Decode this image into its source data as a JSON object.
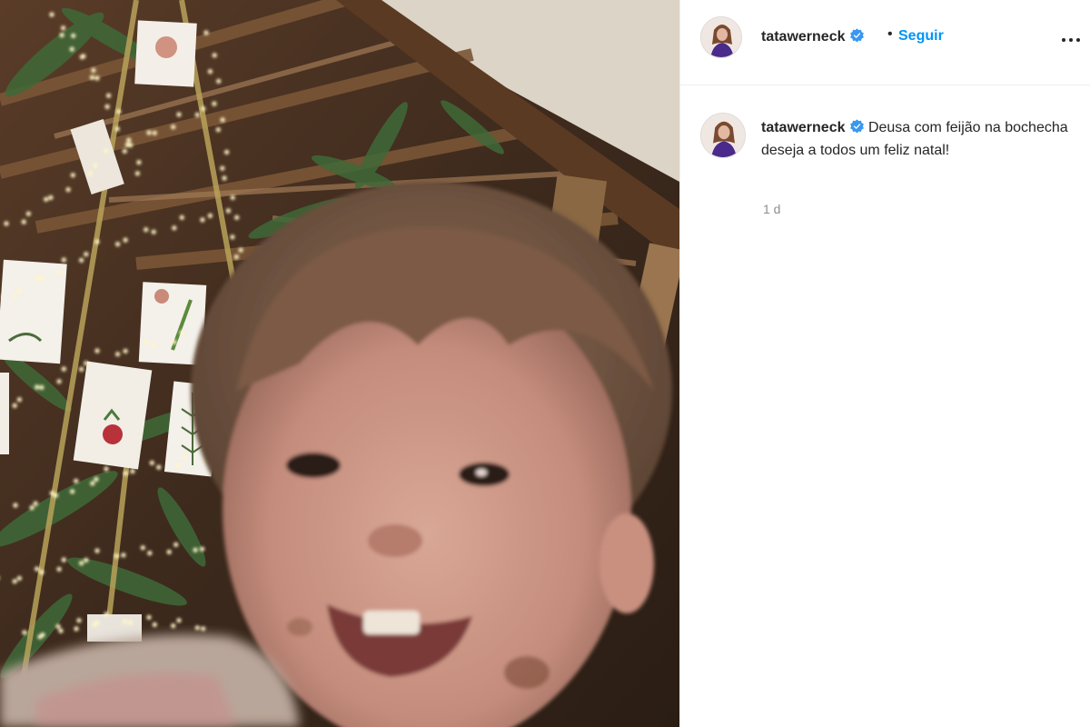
{
  "post": {
    "username": "tatawerneck",
    "separator": "•",
    "follow_label": "Seguir",
    "more_icon": "more-options-icon",
    "verified_icon": "verified-badge-icon",
    "caption_text": "Deusa com feijão na bochecha deseja a todos um feliz natal!",
    "timestamp": "1 d"
  },
  "colors": {
    "follow_blue": "#0095f6",
    "verified_blue": "#3897f0",
    "muted_text": "#8e8e8e",
    "divider": "#efefef"
  }
}
